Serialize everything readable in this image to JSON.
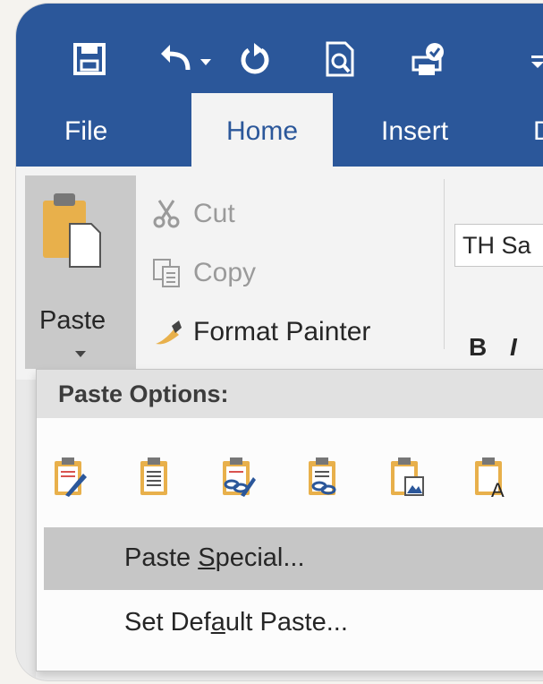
{
  "quick_access": {
    "icons": [
      "save-icon",
      "undo-icon",
      "undo-dropdown-icon",
      "redo-icon",
      "print-preview-icon",
      "spelling-icon",
      "customize-icon"
    ]
  },
  "tabs": [
    {
      "label": "File"
    },
    {
      "label": "Home"
    },
    {
      "label": "Insert"
    },
    {
      "label": "D"
    }
  ],
  "clipboard": {
    "paste_label": "Paste",
    "cut_label": "Cut",
    "copy_label": "Copy",
    "format_painter_label": "Format Painter"
  },
  "font": {
    "name_value": "TH Sa",
    "bold_label": "B",
    "italic_label": "I"
  },
  "paste_menu": {
    "header": "Paste Options:",
    "option_icons": [
      "keep-source-formatting-icon",
      "merge-formatting-icon",
      "keep-source-link-icon",
      "merge-link-icon",
      "picture-icon",
      "keep-text-only-icon"
    ],
    "paste_special": {
      "pre": "Paste ",
      "u": "S",
      "post": "pecial..."
    },
    "set_default": {
      "pre": "Set Def",
      "u": "a",
      "post": "ult Paste..."
    }
  },
  "colors": {
    "ribbon_blue": "#2b579a",
    "clipboard_gold": "#e8b04b",
    "menu_highlight": "#c6c6c6"
  }
}
